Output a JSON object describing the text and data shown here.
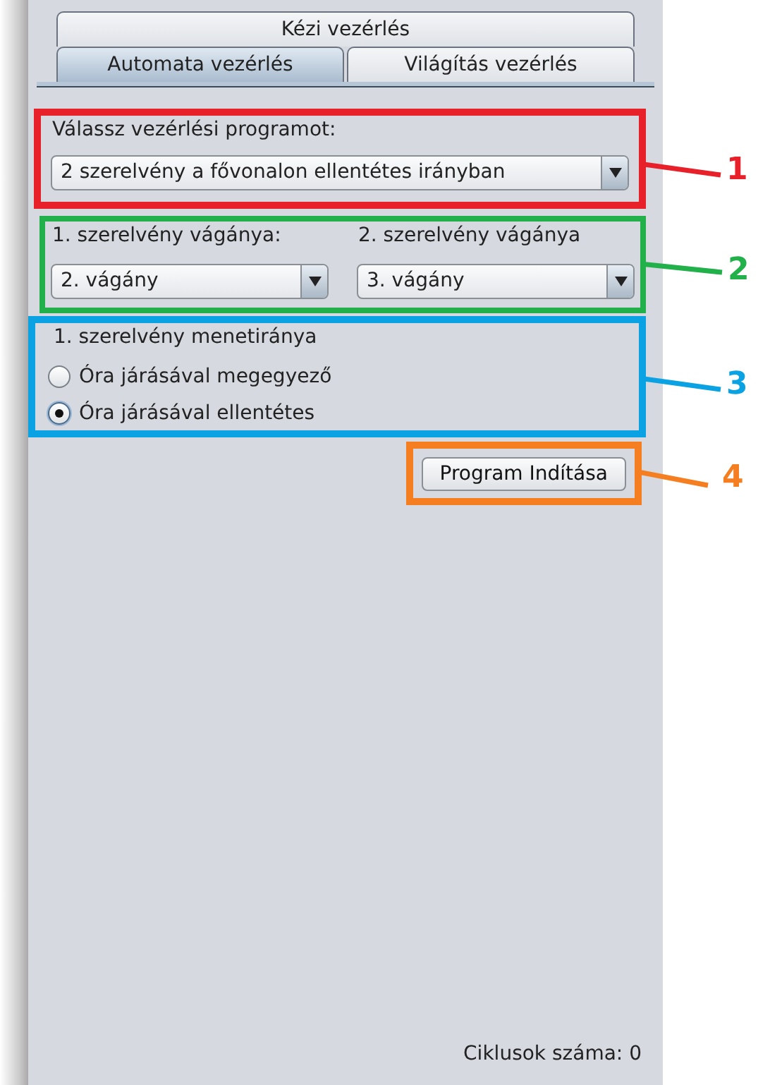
{
  "tab_rows": [
    [
      {
        "label": "Kézi vezérlés",
        "selected": false
      }
    ],
    [
      {
        "label": "Automata vezérlés",
        "selected": true
      },
      {
        "label": "Világítás vezérlés",
        "selected": false
      }
    ]
  ],
  "program_section": {
    "annotation": {
      "number": "1",
      "color": "#e8202a"
    },
    "label": "Válassz vezérlési programot:",
    "combo": {
      "value": "2 szerelvény a fővonalon ellentétes irányban"
    }
  },
  "track_section": {
    "annotation": {
      "number": "2",
      "color": "#22b04a"
    },
    "fields": [
      {
        "label": "1. szerelvény vágánya:",
        "value": "2. vágány"
      },
      {
        "label": "2. szerelvény vágánya",
        "value": "3. vágány"
      }
    ]
  },
  "direction_section": {
    "annotation": {
      "number": "3",
      "color": "#0aa2e2"
    },
    "label": "1. szerelvény menetiránya",
    "options": [
      {
        "label": "Óra járásával megegyező",
        "selected": false
      },
      {
        "label": "Óra járásával ellentétes",
        "selected": true
      }
    ]
  },
  "start_section": {
    "annotation": {
      "number": "4",
      "color": "#f47e20"
    },
    "button": "Program Indítása"
  },
  "status": "Ciklusok száma: 0"
}
